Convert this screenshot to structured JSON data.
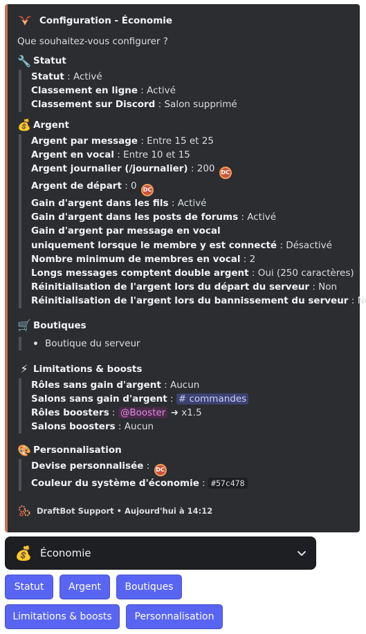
{
  "embed": {
    "author_name": "Configuration - Économie",
    "description": "Que souhaitez-vous configurer ?",
    "accent_color": "#c87353",
    "sections": {
      "statut": {
        "icon": "wrench-icon",
        "title": "Statut",
        "lines": [
          {
            "label": "Statut",
            "value": " : Activé"
          },
          {
            "label": "Classement en ligne",
            "value": " : Activé"
          },
          {
            "label": "Classement sur Discord",
            "value": " : Salon supprimé"
          }
        ]
      },
      "argent": {
        "icon": "money-bag-icon",
        "title": "Argent",
        "lines": [
          {
            "label": "Argent par message",
            "value": " : Entre 15 et 25"
          },
          {
            "label": "Argent en vocal",
            "value": " : Entre 10 et 15"
          },
          {
            "label": "Argent journalier (/journalier)",
            "value": " : 200"
          },
          {
            "label": "Argent de départ",
            "value": " : 0"
          },
          {
            "label": "Gain d'argent dans les fils",
            "value": " : Activé"
          },
          {
            "label": "Gain d'argent dans les posts de forums",
            "value": " : Activé"
          },
          {
            "label": "Gain d'argent par message en vocal",
            "value": ""
          },
          {
            "label": "uniquement lorsque le membre y est connecté",
            "value": " : Désactivé"
          },
          {
            "label": "Nombre minimum de membres en vocal",
            "value": " : 2"
          },
          {
            "label": "Longs messages comptent double argent",
            "value": " : Oui (250 caractères)"
          },
          {
            "label": "Réinitialisation de l'argent lors du départ du serveur",
            "value": " : Non"
          },
          {
            "label": "Réinitialisation de l'argent lors du bannissement du serveur",
            "value": " : Non"
          }
        ]
      },
      "boutiques": {
        "icon": "shopping-cart-icon",
        "title": "Boutiques",
        "items": [
          "Boutique du serveur"
        ]
      },
      "limitations": {
        "icon": "lightning-icon",
        "title": "Limitations & boosts",
        "lines": [
          {
            "label": "Rôles sans gain d'argent",
            "value": " : Aucun"
          },
          {
            "label": "Salons sans gain d'argent",
            "value": " : ",
            "channel": "# commandes"
          },
          {
            "label": "Rôles boosters",
            "value": " : ",
            "role": "@Booster",
            "suffix": " ➜ x1.5"
          },
          {
            "label": "Salons boosters",
            "value": " : Aucun"
          }
        ]
      },
      "personnalisation": {
        "icon": "palette-icon",
        "title": "Personnalisation",
        "lines": [
          {
            "label": "Devise personnalisée",
            "value": " :"
          },
          {
            "label": "Couleur du système d'économie",
            "value": " : ",
            "code": "#57c478"
          }
        ]
      }
    },
    "footer": "DraftBot Support • Aujourd'hui à 14:12"
  },
  "select_menu": {
    "icon": "money-bag-icon",
    "selected": "Économie"
  },
  "buttons": {
    "statut": "Statut",
    "argent": "Argent",
    "boutiques": "Boutiques",
    "limitations": "Limitations & boosts",
    "personnalisation": "Personnalisation"
  },
  "colors": {
    "embed_bg": "#2b2d31",
    "accent": "#c87353",
    "button": "#5865f2"
  }
}
